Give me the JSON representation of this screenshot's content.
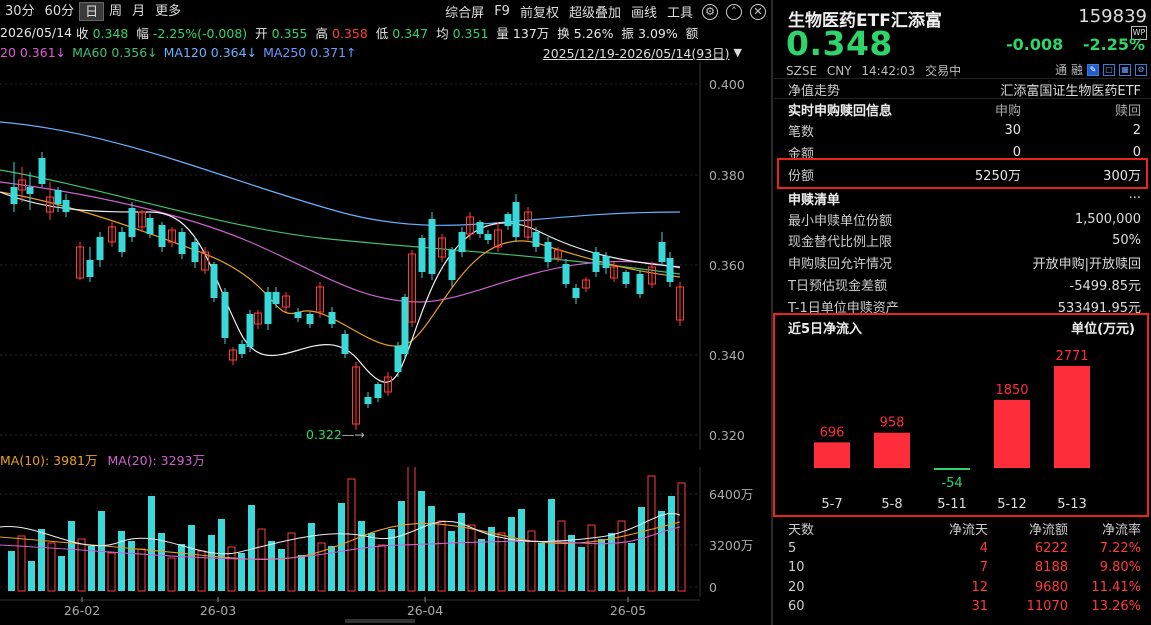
{
  "toolbar": {
    "periods": [
      "30分",
      "60分",
      "日",
      "周",
      "月",
      "更多"
    ],
    "active_period": "日",
    "actions": [
      "综合屏",
      "F9",
      "前复权",
      "超级叠加",
      "画线",
      "工具"
    ]
  },
  "info": {
    "date": "2026/05/14",
    "close_label": "收",
    "close": "0.348",
    "amp_label": "幅",
    "amp": "-2.25%(-0.008)",
    "open_label": "开",
    "open": "0.355",
    "high_label": "高",
    "high": "0.358",
    "low_label": "低",
    "low": "0.347",
    "avg_label": "均",
    "avg": "0.351",
    "vol_label": "量",
    "vol": "137万",
    "turnover_label": "换",
    "turnover": "5.26%",
    "swing_label": "振",
    "swing": "3.09%",
    "amount_label": "额"
  },
  "ma_line": {
    "ma20": "20 0.361↓",
    "ma60": "MA60 0.356↓",
    "ma120": "MA120 0.364↓",
    "ma250": "MA250 0.371↑",
    "range": "2025/12/19-2026/05/14(93日)"
  },
  "price_axis": [
    "0.400",
    "0.380",
    "0.360",
    "0.340",
    "0.320"
  ],
  "low_marker": "0.322",
  "vol_legend": {
    "ma10": "MA(10): 3981万",
    "ma20": "MA(20): 3293万"
  },
  "vol_axis": [
    "6400万",
    "3200万",
    "0"
  ],
  "x_axis": [
    "26-02",
    "26-03",
    "26-04",
    "26-05"
  ],
  "fund": {
    "name": "生物医药ETF汇添富",
    "code": "159839",
    "price": "0.348",
    "change": "-0.008",
    "change_pct": "-2.25%",
    "exchange": "SZSE",
    "currency": "CNY",
    "time": "14:42:03",
    "state": "交易中",
    "right_label": "通 融"
  },
  "nav_row": {
    "label": "净值走势",
    "value": "汇添富国证生物医药ETF"
  },
  "sub_redeem": {
    "title": "实时申购赎回信息",
    "col_sub": "申购",
    "col_red": "赎回",
    "rows": [
      {
        "label": "笔数",
        "sub": "30",
        "red": "2"
      },
      {
        "label": "金额",
        "sub": "0",
        "red": "0"
      },
      {
        "label": "份额",
        "sub": "5250万",
        "red": "300万"
      }
    ]
  },
  "list": {
    "title": "申赎清单",
    "more": "···",
    "rows": [
      {
        "label": "最小申赎单位份额",
        "value": "1,500,000"
      },
      {
        "label": "现金替代比例上限",
        "value": "50%"
      },
      {
        "label": "申购赎回允许情况",
        "value": "开放申购|开放赎回"
      },
      {
        "label": "T日预估现金差额",
        "value": "-5499.85元"
      },
      {
        "label": "T-1日单位申赎资产",
        "value": "533491.95元"
      }
    ]
  },
  "flow": {
    "title": "近5日净流入",
    "unit": "单位(万元)"
  },
  "chart_data": {
    "type": "bar",
    "categories": [
      "5-7",
      "5-8",
      "5-11",
      "5-12",
      "5-13"
    ],
    "values": [
      696,
      958,
      -54,
      1850,
      2771
    ],
    "title": "近5日净流入",
    "ylabel": "单位(万元)"
  },
  "stats": {
    "headers": [
      "天数",
      "净流天",
      "净流额",
      "净流率"
    ],
    "rows": [
      [
        "5",
        "4",
        "6222",
        "7.22%"
      ],
      [
        "10",
        "7",
        "8188",
        "9.80%"
      ],
      [
        "20",
        "12",
        "9680",
        "11.41%"
      ],
      [
        "60",
        "31",
        "11070",
        "13.26%"
      ]
    ]
  },
  "colors": {
    "up": "#ff3b3b",
    "down": "#2fd46a",
    "candle_down": "#3ad8d8",
    "highlight": "#e8241c"
  }
}
